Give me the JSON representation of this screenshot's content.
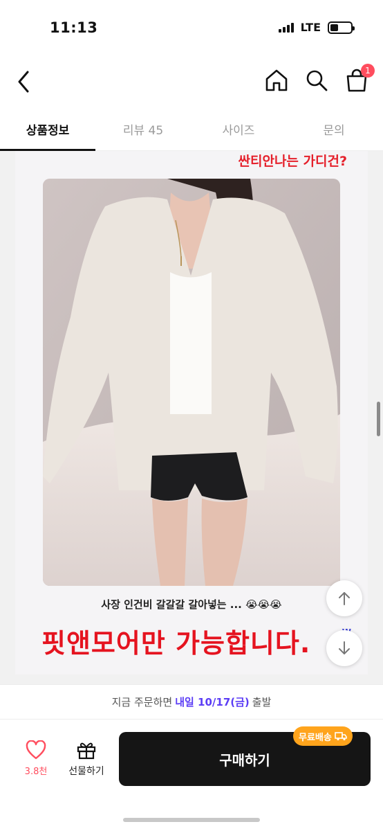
{
  "status_bar": {
    "time": "11:13",
    "network": "LTE"
  },
  "header": {
    "cart_count": "1"
  },
  "tabs": [
    {
      "label": "상품정보",
      "active": true
    },
    {
      "label": "리뷰 45",
      "active": false
    },
    {
      "label": "사이즈",
      "active": false
    },
    {
      "label": "문의",
      "active": false
    }
  ],
  "content": {
    "headline": "싼티안나는 가디건?",
    "caption": "사장 인건비 갈갈갈 갈아넣는 ... 😭😭😭",
    "big_text": "핏앤모어만 가능합니다.",
    "edge_mark": "W"
  },
  "delivery": {
    "prefix": "지금 주문하면",
    "highlight": "내일 10/17(금)",
    "suffix": "출발"
  },
  "bottom": {
    "like_count": "3.8천",
    "gift_label": "선물하기",
    "buy_label": "구매하기",
    "free_shipping": "무료배송"
  },
  "colors": {
    "accent": "#5b3df5",
    "sale_red": "#e5131f",
    "badge": "#ffa41c",
    "heart": "#ff4d5e"
  }
}
